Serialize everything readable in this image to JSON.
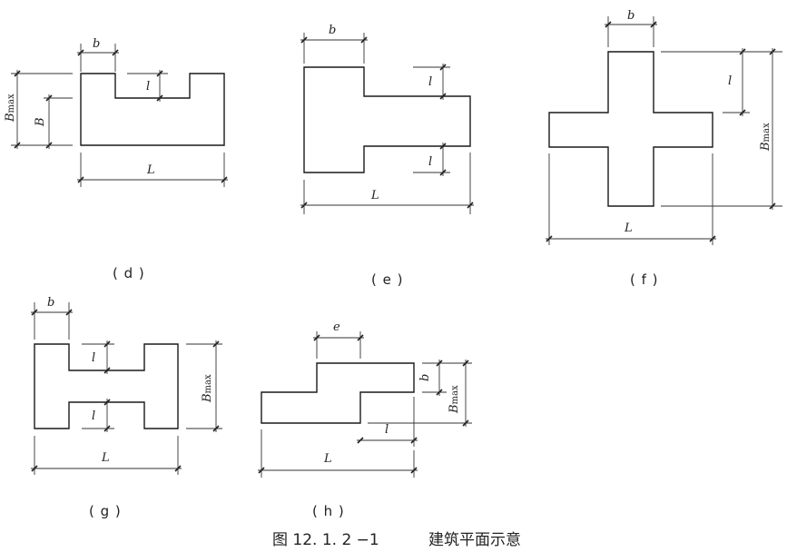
{
  "caption": {
    "number": "图 12. 1. 2 −1",
    "title": "建筑平面示意"
  },
  "figures": {
    "d": {
      "label": "( d )",
      "dims": {
        "b": "b",
        "l": "l",
        "Bmax_main": "B",
        "Bmax_sub": "max",
        "B": "B",
        "L": "L"
      }
    },
    "e": {
      "label": "( e )",
      "dims": {
        "b": "b",
        "l_top": "l",
        "l_bottom": "l",
        "L": "L"
      }
    },
    "f": {
      "label": "( f )",
      "dims": {
        "b": "b",
        "l": "l",
        "Bmax_main": "B",
        "Bmax_sub": "max",
        "L": "L"
      }
    },
    "g": {
      "label": "( g )",
      "dims": {
        "b": "b",
        "l_top": "l",
        "l_bottom": "l",
        "Bmax_main": "B",
        "Bmax_sub": "max",
        "L": "L"
      }
    },
    "h": {
      "label": "( h )",
      "dims": {
        "e": "e",
        "b": "b",
        "Bmax_main": "B",
        "Bmax_sub": "max",
        "l": "l",
        "L": "L"
      }
    }
  }
}
